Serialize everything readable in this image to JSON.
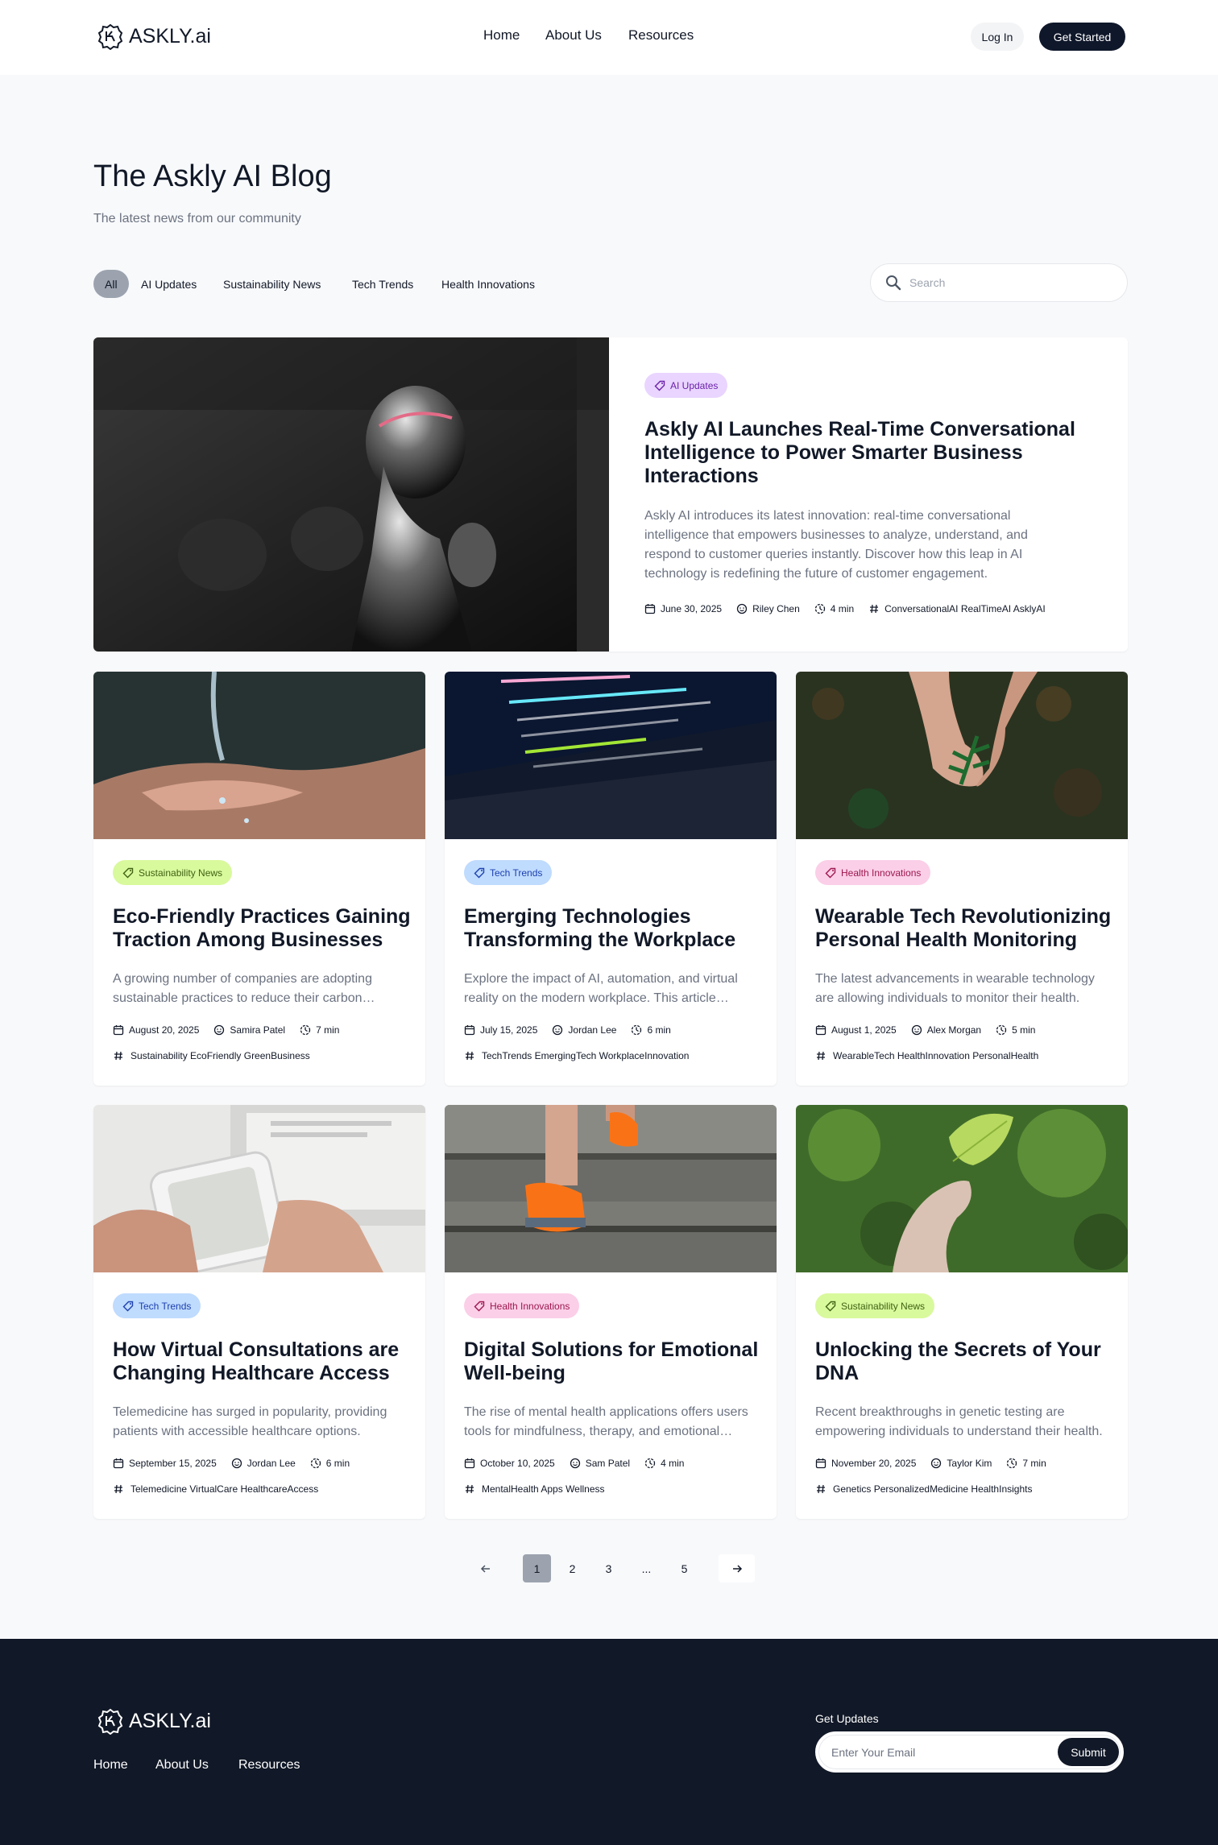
{
  "header": {
    "logo_text": "ASKLY.ai",
    "nav": [
      "Home",
      "About Us",
      "Resources"
    ],
    "login_label": "Log In",
    "cta_label": "Get Started"
  },
  "hero": {
    "title": "The Askly AI Blog",
    "subtitle": "The latest news from our community"
  },
  "filters": {
    "items": [
      "All",
      "AI Updates",
      "Sustainability News",
      "Tech Trends",
      "Health Innovations"
    ],
    "active": "All"
  },
  "search": {
    "placeholder": "Search"
  },
  "featured": {
    "tag": "AI Updates",
    "title": "Askly AI Launches Real-Time Conversational Intelligence to Power Smarter Business Interactions",
    "desc": "Askly AI introduces its latest innovation: real-time conversational intelligence that empowers businesses to analyze, understand, and respond to customer queries instantly. Discover how this leap in AI technology is redefining the future of customer engagement.",
    "date": "June 30, 2025",
    "author": "Riley Chen",
    "read": "4 min",
    "tags": "ConversationalAI RealTimeAI AsklyAI"
  },
  "posts": [
    {
      "tag": "Sustainability News",
      "title": "Eco-Friendly Practices Gaining Traction Among Businesses",
      "desc": "A growing number of companies are adopting sustainable practices to reduce their carbon footprint.",
      "date": "August 20, 2025",
      "author": "Samira Patel",
      "read": "7 min",
      "tags": "Sustainability EcoFriendly GreenBusiness"
    },
    {
      "tag": "Tech Trends",
      "title": "Emerging Technologies Transforming the Workplace",
      "desc": "Explore the impact of AI, automation, and virtual reality on the modern workplace. This article discusses emerging trends.",
      "date": "July 15, 2025",
      "author": "Jordan Lee",
      "read": "6 min",
      "tags": "TechTrends EmergingTech WorkplaceInnovation"
    },
    {
      "tag": "Health Innovations",
      "title": "Wearable Tech Revolutionizing Personal Health Monitoring",
      "desc": "The latest advancements in wearable technology are allowing individuals to monitor their health.",
      "date": "August 1, 2025",
      "author": "Alex Morgan",
      "read": "5 min",
      "tags": "WearableTech HealthInnovation PersonalHealth"
    },
    {
      "tag": "Tech Trends",
      "title": "How Virtual Consultations are Changing Healthcare Access",
      "desc": "Telemedicine has surged in popularity, providing patients with accessible healthcare options.",
      "date": "September 15, 2025",
      "author": "Jordan Lee",
      "read": "6 min",
      "tags": "Telemedicine VirtualCare HealthcareAccess"
    },
    {
      "tag": "Health Innovations",
      "title": "Digital Solutions for Emotional Well-being",
      "desc": "The rise of mental health applications offers users tools for mindfulness, therapy, and emotional support.",
      "date": "October 10, 2025",
      "author": "Sam Patel",
      "read": "4 min",
      "tags": "MentalHealth Apps Wellness"
    },
    {
      "tag": "Sustainability News",
      "title": "Unlocking the Secrets of Your DNA",
      "desc": "Recent breakthroughs in genetic testing are empowering individuals to understand their health.",
      "date": "November 20, 2025",
      "author": "Taylor Kim",
      "read": "7 min",
      "tags": "Genetics PersonalizedMedicine HealthInsights"
    }
  ],
  "pagination": {
    "pages": [
      "1",
      "2",
      "3",
      "...",
      "5"
    ],
    "current": "1"
  },
  "footer": {
    "logo_text": "ASKLY.ai",
    "links": [
      "Home",
      "About Us",
      "Resources"
    ],
    "updates_label": "Get Updates",
    "email_placeholder": "Enter Your Email",
    "submit_label": "Submit"
  },
  "colors": {
    "brand_dark": "#0f172a",
    "footer_bg": "#111827",
    "tag_ai": "#e9d5ff",
    "tag_sustainability": "#d9f99d",
    "tag_tech": "#bfdbfe",
    "tag_health": "#fbcfe8"
  }
}
